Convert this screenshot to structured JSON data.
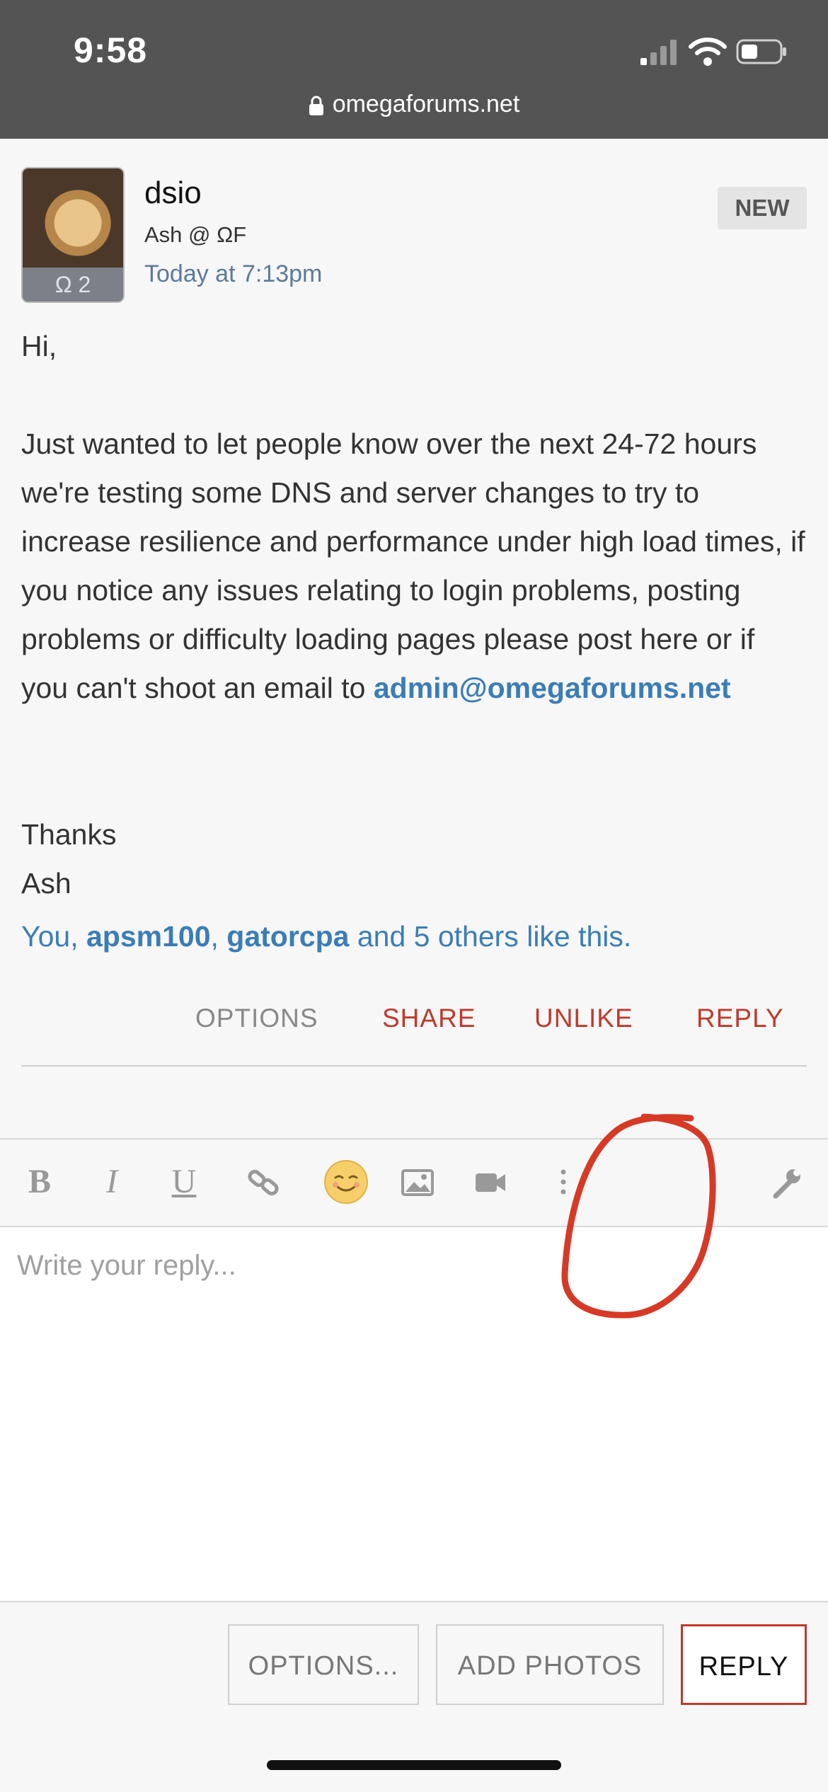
{
  "status_bar": {
    "time": "9:58",
    "url": "omegaforums.net"
  },
  "post": {
    "username": "dsio",
    "user_title": "Ash @ ΩF",
    "timestamp": "Today at 7:13pm",
    "avatar_rank": "Ω 2",
    "badge": "NEW",
    "body": {
      "greeting": "Hi,",
      "paragraph": "Just wanted to let people know over the next 24-72 hours we're testing some DNS and server changes to try to increase resilience and performance under high load times, if you notice any issues relating to login problems, posting problems or difficulty loading pages please post here or if you can't shoot an email to",
      "email": "admin@omegaforums.net",
      "sign_off_1": "Thanks",
      "sign_off_2": "Ash"
    },
    "likes": {
      "you": "You, ",
      "user1": "apsm100",
      "comma": ", ",
      "user2": "gatorcpa",
      "and": " and ",
      "others": "5 others",
      "suffix": " like this."
    },
    "actions": {
      "options": "OPTIONS",
      "share": "SHARE",
      "unlike": "UNLIKE",
      "reply": "REPLY"
    }
  },
  "editor": {
    "toolbar": {
      "bold": "B",
      "italic": "I",
      "underline": "U"
    },
    "placeholder": "Write your reply..."
  },
  "bottom_buttons": {
    "options": "OPTIONS...",
    "add_photos": "ADD PHOTOS",
    "reply": "REPLY"
  },
  "colors": {
    "accent_red": "#c0392b",
    "link_blue": "#3b7db6",
    "annotation_red": "#d63a26"
  }
}
